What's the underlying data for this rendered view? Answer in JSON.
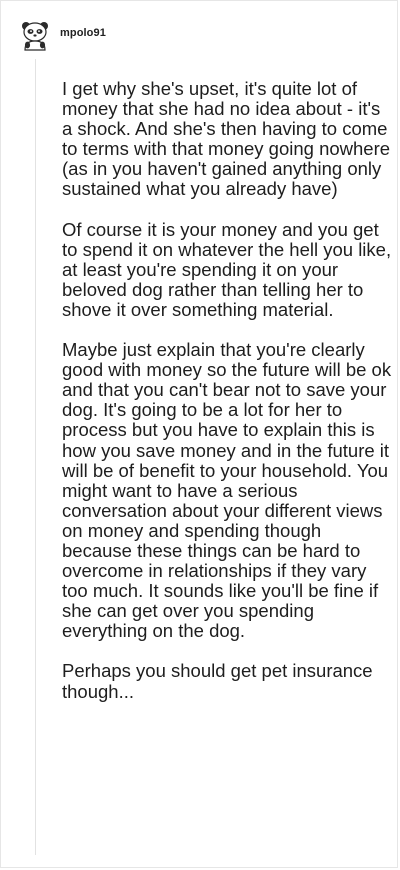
{
  "comment": {
    "username": "mpolo91",
    "avatar_icon": "panda-avatar-icon",
    "paragraphs": [
      "I get why she's upset, it's quite lot of money that she had no idea about - it's a shock. And she's then having to come to terms with that money going nowhere (as in you haven't gained anything only sustained what you already have)",
      "Of course it is your money and you get to spend it on whatever the hell you like, at least you're spending it on your beloved dog rather than telling her to shove it over something material.",
      "Maybe just explain that you're clearly good with money so the future will be ok and that you can't bear not to save your dog. It's going to be a lot for her to process but you have to explain this is how you save money and in the future it will be of benefit to your household. You might want to have a serious conversation about your different views on money and spending though because these things can be hard to overcome in relationships if they vary too much. It sounds like you'll be fine if she can get over you spending everything on the dog.",
      "Perhaps you should get pet insurance though..."
    ]
  }
}
